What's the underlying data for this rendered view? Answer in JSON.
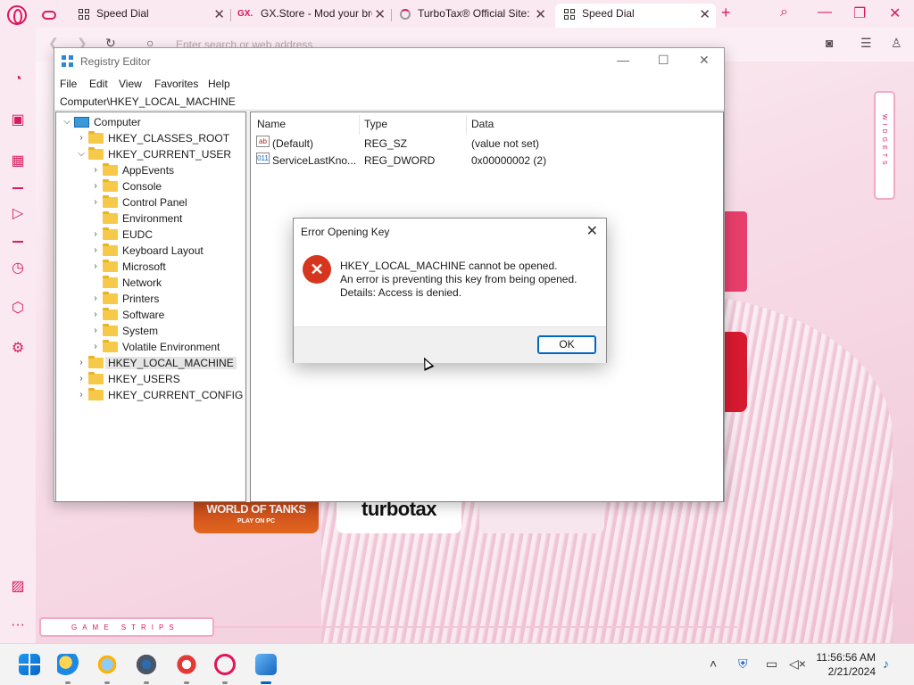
{
  "browser": {
    "tabs": [
      {
        "label": "",
        "icon": "gamepad-icon"
      },
      {
        "label": "Speed Dial",
        "icon": "grid-icon"
      },
      {
        "label": "GX.Store - Mod your bro",
        "icon": "gx-icon"
      },
      {
        "label": "TurboTax® Official Site:",
        "icon": "loading-icon"
      },
      {
        "label": "Speed Dial",
        "icon": "grid-icon",
        "active": true
      }
    ],
    "address_placeholder": "Enter search or web address"
  },
  "page": {
    "widgets_label": "WIDGETS",
    "game_strips_label": "GAME STRIPS",
    "tiles": {
      "wot_title": "WORLD OF TANKS",
      "wot_sub": "PLAY ON PC",
      "turbotax": "turbotax"
    }
  },
  "regedit": {
    "title": "Registry Editor",
    "menu": [
      "File",
      "Edit",
      "View",
      "Favorites",
      "Help"
    ],
    "path": "Computer\\HKEY_LOCAL_MACHINE",
    "tree": [
      {
        "label": "Computer",
        "level": 0,
        "expanded": true,
        "type": "pc"
      },
      {
        "label": "HKEY_CLASSES_ROOT",
        "level": 1,
        "expanded": false
      },
      {
        "label": "HKEY_CURRENT_USER",
        "level": 1,
        "expanded": true
      },
      {
        "label": "AppEvents",
        "level": 2,
        "expanded": false
      },
      {
        "label": "Console",
        "level": 2,
        "expanded": false
      },
      {
        "label": "Control Panel",
        "level": 2,
        "expanded": false
      },
      {
        "label": "Environment",
        "level": 2,
        "expanded": null
      },
      {
        "label": "EUDC",
        "level": 2,
        "expanded": false
      },
      {
        "label": "Keyboard Layout",
        "level": 2,
        "expanded": false
      },
      {
        "label": "Microsoft",
        "level": 2,
        "expanded": false
      },
      {
        "label": "Network",
        "level": 2,
        "expanded": null
      },
      {
        "label": "Printers",
        "level": 2,
        "expanded": false
      },
      {
        "label": "Software",
        "level": 2,
        "expanded": false
      },
      {
        "label": "System",
        "level": 2,
        "expanded": false
      },
      {
        "label": "Volatile Environment",
        "level": 2,
        "expanded": false
      },
      {
        "label": "HKEY_LOCAL_MACHINE",
        "level": 1,
        "expanded": false,
        "selected": true
      },
      {
        "label": "HKEY_USERS",
        "level": 1,
        "expanded": false
      },
      {
        "label": "HKEY_CURRENT_CONFIG",
        "level": 1,
        "expanded": false
      }
    ],
    "columns": [
      "Name",
      "Type",
      "Data"
    ],
    "values": [
      {
        "name": "(Default)",
        "type": "REG_SZ",
        "data": "(value not set)",
        "icon": "string-value-icon"
      },
      {
        "name": "ServiceLastKno...",
        "type": "REG_DWORD",
        "data": "0x00000002 (2)",
        "icon": "binary-value-icon"
      }
    ]
  },
  "dialog": {
    "title": "Error Opening Key",
    "line1": "HKEY_LOCAL_MACHINE cannot be opened.",
    "line2": "An error is preventing this key from being opened.",
    "line3": "Details: Access is denied.",
    "ok_label": "OK"
  },
  "taskbar": {
    "time": "11:56:56 AM",
    "date": "2/21/2024"
  }
}
